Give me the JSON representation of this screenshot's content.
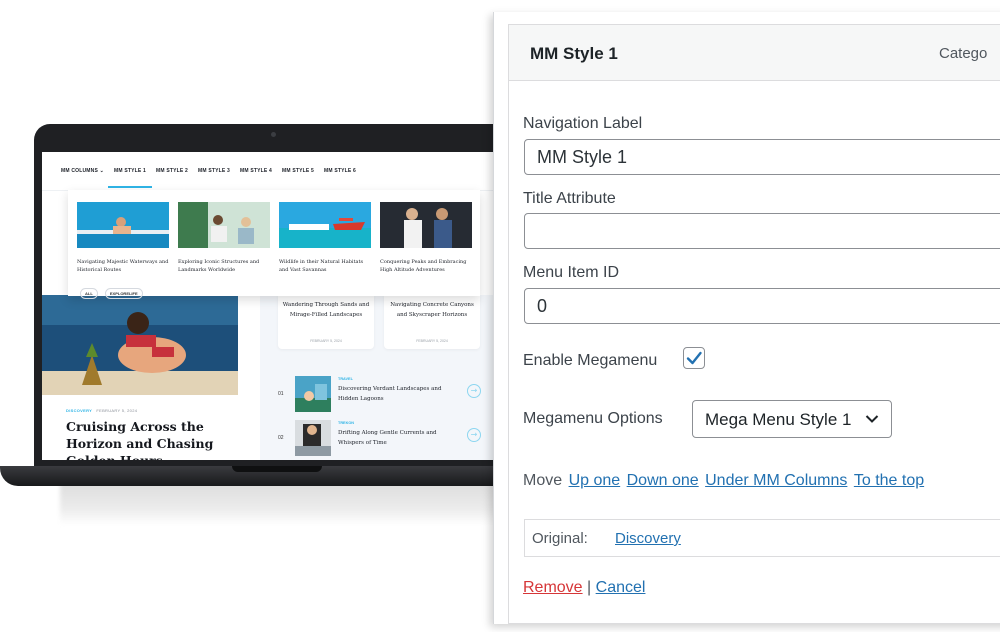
{
  "site": {
    "nav": [
      "MM COLUMNS",
      "MM STYLE 1",
      "MM STYLE 2",
      "MM STYLE 3",
      "MM STYLE 4",
      "MM STYLE 5",
      "MM STYLE 6"
    ],
    "mega_cards": [
      "Navigating Majestic Waterways and Historical Routes",
      "Exploring Iconic Structures and Landmarks Worldwide",
      "Wildlife in their Natural Habitats and Vast Savannas",
      "Conquering Peaks and Embracing High Altitude Adventures"
    ],
    "tags": [
      "ALL",
      "EXPLORELIFE"
    ],
    "hero": {
      "category": "DISCOVERY",
      "date": "FEBRUARY 5, 2024",
      "title": "Cruising Across the Horizon and Chasing Golden Hours"
    },
    "mini_cards": [
      {
        "title": "Wandering Through Sands and Mirage-Filled Landscapes",
        "date": "FEBRUARY 5, 2024"
      },
      {
        "title": "Navigating Concrete Canyons and Skyscraper Horizons",
        "date": "FEBRUARY 5, 2024"
      }
    ],
    "list": [
      {
        "num": "01",
        "category": "TRAVEL",
        "title": "Discovering Verdant Landscapes and Hidden Lagoons"
      },
      {
        "num": "02",
        "category": "TREKON",
        "title": "Drifting Along Gentle Currents and Whispers of Time"
      }
    ]
  },
  "panel": {
    "title": "MM Style 1",
    "item_type": "Catego",
    "nav_label_label": "Navigation Label",
    "nav_label_value": "MM Style 1",
    "title_attr_label": "Title Attribute",
    "title_attr_value": "",
    "menu_item_id_label": "Menu Item ID",
    "menu_item_id_value": "0",
    "enable_megamenu_label": "Enable Megamenu",
    "enable_megamenu_checked": true,
    "megamenu_options_label": "Megamenu Options",
    "megamenu_options_value": "Mega Menu Style 1",
    "move_label": "Move",
    "move_links": [
      "Up one",
      "Down one",
      "Under MM Columns",
      "To the top"
    ],
    "original_label": "Original:",
    "original_link": "Discovery",
    "remove_label": "Remove",
    "separator": "|",
    "cancel_label": "Cancel"
  },
  "colors": {
    "accent": "#2fb4e6",
    "wp_link": "#2271b1",
    "wp_remove": "#d63638"
  }
}
